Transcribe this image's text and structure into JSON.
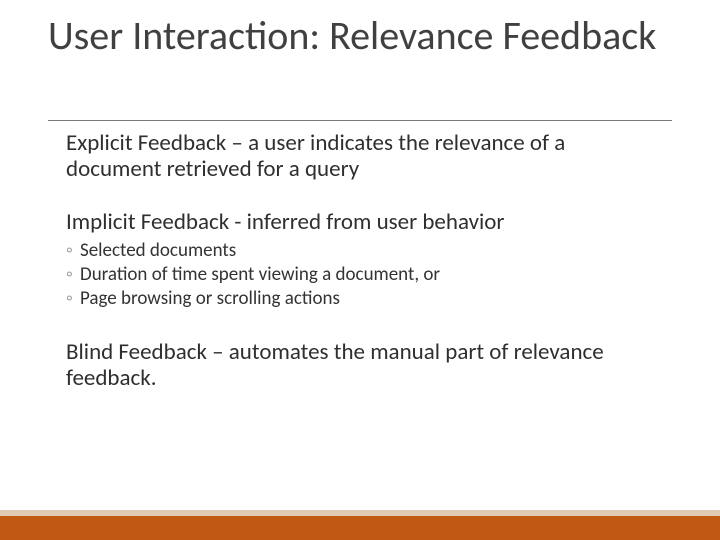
{
  "title": "User Interaction: Relevance Feedback",
  "body": {
    "explicit": "Explicit Feedback – a user indicates the relevance of a document retrieved for a query",
    "implicit": "Implicit Feedback - inferred from user behavior",
    "implicit_subs": [
      "Selected documents",
      "Duration of time spent viewing a document, or",
      "Page browsing or scrolling actions"
    ],
    "blind": "Blind Feedback – automates the manual part of relevance feedback."
  },
  "bullet": "◦",
  "colors": {
    "accent_dark": "#c15912",
    "accent_light": "#e0cab3"
  }
}
